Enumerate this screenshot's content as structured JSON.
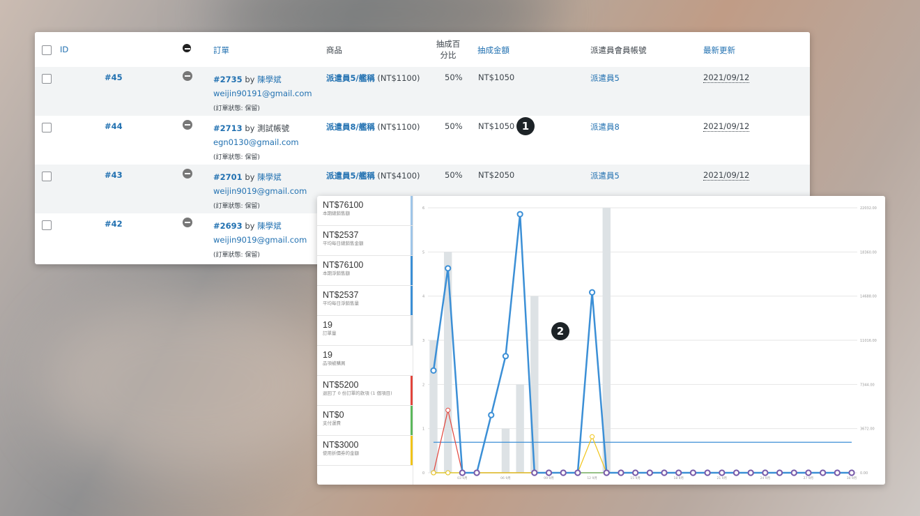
{
  "table": {
    "headers": {
      "id": "ID",
      "order": "訂單",
      "product": "商品",
      "rate_line1": "抽成百",
      "rate_line2": "分比",
      "amount": "抽成金額",
      "account": "派遣員會員帳號",
      "updated": "最新更新"
    },
    "rows": [
      {
        "id": "#45",
        "order_no": "#2735",
        "by": "by",
        "customer": "陳學斌",
        "email": "weijin90191@gmail.com",
        "status": "(訂單狀態: 保留)",
        "product_link": "派遣員5/艦稱",
        "product_price": "(NT$1100)",
        "rate": "50%",
        "amount": "NT$1050",
        "account": "派遣員5",
        "date": "2021/09/12"
      },
      {
        "id": "#44",
        "order_no": "#2713",
        "by": "by",
        "customer": "測試帳號",
        "email": "egn0130@gmail.com",
        "status": "(訂單狀態: 保留)",
        "product_link": "派遣員8/艦稱",
        "product_price": "(NT$1100)",
        "rate": "50%",
        "amount": "NT$1050",
        "account": "派遣員8",
        "date": "2021/09/12"
      },
      {
        "id": "#43",
        "order_no": "#2701",
        "by": "by",
        "customer": "陳學斌",
        "email": "weijin9019@gmail.com",
        "status": "(訂單狀態: 保留)",
        "product_link": "派遣員5/艦稱",
        "product_price": "(NT$4100)",
        "rate": "50%",
        "amount": "NT$2050",
        "account": "派遣員5",
        "date": "2021/09/12"
      },
      {
        "id": "#42",
        "order_no": "#2693",
        "by": "by",
        "customer": "陳學斌",
        "email": "weijin9019@gmail.com",
        "status": "(訂單狀態: 保留)"
      }
    ]
  },
  "markers": {
    "one": "1",
    "two": "2"
  },
  "stats": [
    {
      "value": "NT$76100",
      "label": "本期總銷售額",
      "color": "#9fc5e8"
    },
    {
      "value": "NT$2537",
      "label": "平均每日總銷售金額",
      "color": "#9fc5e8"
    },
    {
      "value": "NT$76100",
      "label": "本期淨銷售額",
      "color": "#3b8fd6"
    },
    {
      "value": "NT$2537",
      "label": "平均每日淨銷售量",
      "color": "#3b8fd6"
    },
    {
      "value": "19",
      "label": "訂單量",
      "color": "#cfd6db"
    },
    {
      "value": "19",
      "label": "品項被購買",
      "color": "#ffffff"
    },
    {
      "value": "NT$5200",
      "label": "退回了 0 份訂單的款項 (1 個項目)",
      "color": "#e2453c"
    },
    {
      "value": "NT$0",
      "label": "支付運費",
      "color": "#5cb85c"
    },
    {
      "value": "NT$3000",
      "label": "使用折價券的金額",
      "color": "#f0c419"
    }
  ],
  "chart_data": {
    "type": "line",
    "y_left_ticks": [
      "0",
      "1",
      "2",
      "3",
      "4",
      "5",
      "6"
    ],
    "y_right_ticks": [
      "0.00",
      "3672.00",
      "7344.00",
      "11016.00",
      "14688.00",
      "18360.00",
      "22032.00"
    ],
    "x_tick_labels": [
      "03 9月",
      "06 9月",
      "09 9月",
      "12 9月",
      "15 9月",
      "18 9月",
      "21 9月",
      "24 9月",
      "27 9月",
      "30 9月"
    ],
    "grid": true,
    "bars_orders": [
      3,
      5,
      0,
      0,
      0,
      1,
      2,
      4,
      0,
      0,
      0,
      0,
      6,
      0,
      0,
      0,
      0,
      0,
      0,
      0,
      0,
      0,
      0,
      0,
      0,
      0,
      0,
      0,
      0,
      0
    ],
    "series": [
      {
        "color": "#3b8fd6",
        "values": [
          8500,
          17000,
          0,
          0,
          4800,
          9700,
          21500,
          0,
          0,
          0,
          0,
          15000,
          0,
          0,
          0,
          0,
          0,
          0,
          0,
          0,
          0,
          0,
          0,
          0,
          0,
          0,
          0,
          0,
          0,
          0
        ]
      },
      {
        "color": "#e2453c",
        "values": [
          0,
          5200,
          0,
          0,
          0,
          0,
          0,
          0,
          0,
          0,
          0,
          0,
          0,
          0,
          0,
          0,
          0,
          0,
          0,
          0,
          0,
          0,
          0,
          0,
          0,
          0,
          0,
          0,
          0,
          0
        ]
      },
      {
        "color": "#5cb85c",
        "values": [
          0,
          0,
          0,
          0,
          0,
          0,
          0,
          0,
          0,
          0,
          0,
          0,
          0,
          0,
          0,
          0,
          0,
          0,
          0,
          0,
          0,
          0,
          0,
          0,
          0,
          0,
          0,
          0,
          0,
          0
        ]
      },
      {
        "color": "#f0c419",
        "values": [
          0,
          0,
          0,
          0,
          0,
          0,
          0,
          0,
          0,
          0,
          0,
          3000,
          0,
          0,
          0,
          0,
          0,
          0,
          0,
          0,
          0,
          0,
          0,
          0,
          0,
          0,
          0,
          0,
          0,
          0
        ]
      }
    ],
    "average_line": 2537,
    "y_right_max": 22032,
    "y_left_max": 6
  }
}
